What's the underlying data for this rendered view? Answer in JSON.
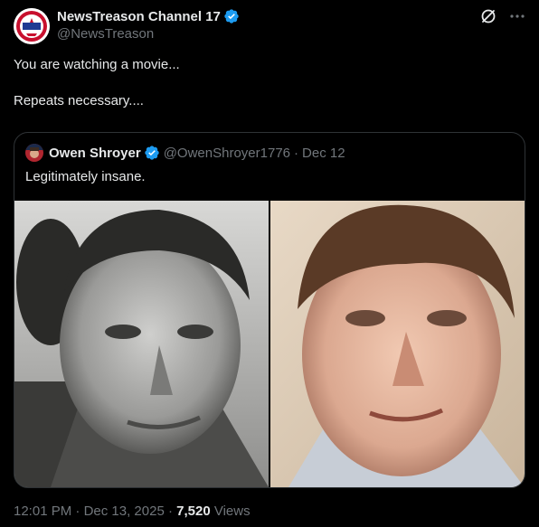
{
  "post": {
    "author": {
      "display_name": "NewsTreason Channel 17",
      "handle": "@NewsTreason",
      "verified": true,
      "avatar_text": "NEWS TREASON"
    },
    "text_lines": [
      "You are watching a movie...",
      "Repeats necessary...."
    ],
    "timestamp": "12:01 PM",
    "date": "Dec 13, 2025",
    "views_count": "7,520",
    "views_label": "Views",
    "sep": "·"
  },
  "quote": {
    "author": {
      "display_name": "Owen Shroyer",
      "handle": "@OwenShroyer1776",
      "verified": true
    },
    "date": "Dec 12",
    "text": "Legitimately insane.",
    "images": [
      {
        "name": "quote-image-left",
        "description_icon": "bw-portrait-photo"
      },
      {
        "name": "quote-image-right",
        "description_icon": "color-portrait-photo"
      }
    ]
  },
  "icons": {
    "verified": "verified-badge-icon",
    "grok": "grok-icon",
    "more": "more-icon"
  },
  "colors": {
    "background": "#000000",
    "text_primary": "#e7e9ea",
    "text_secondary": "#71767b",
    "border": "#2f3336",
    "verified_blue": "#1d9bf0"
  }
}
